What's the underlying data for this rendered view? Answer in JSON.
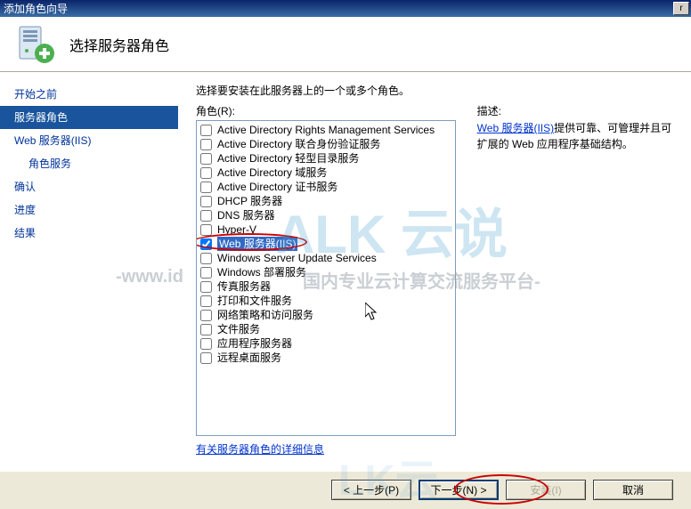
{
  "window": {
    "title": "添加角色向导"
  },
  "header": {
    "title": "选择服务器角色"
  },
  "sidebar": {
    "items": [
      {
        "label": "开始之前",
        "selected": false,
        "indent": false
      },
      {
        "label": "服务器角色",
        "selected": true,
        "indent": false
      },
      {
        "label": "Web 服务器(IIS)",
        "selected": false,
        "indent": false
      },
      {
        "label": "角色服务",
        "selected": false,
        "indent": true
      },
      {
        "label": "确认",
        "selected": false,
        "indent": false
      },
      {
        "label": "进度",
        "selected": false,
        "indent": false
      },
      {
        "label": "结果",
        "selected": false,
        "indent": false
      }
    ]
  },
  "main": {
    "instruction": "选择要安装在此服务器上的一个或多个角色。",
    "roles_label": "角色(R):",
    "desc_label": "描述:",
    "desc_link_text": "Web 服务器(IIS)",
    "desc_body": "提供可靠、可管理并且可扩展的 Web 应用程序基础结构。",
    "roles": [
      {
        "label": "Active Directory Rights Management Services",
        "checked": false
      },
      {
        "label": "Active Directory 联合身份验证服务",
        "checked": false
      },
      {
        "label": "Active Directory 轻型目录服务",
        "checked": false
      },
      {
        "label": "Active Directory 域服务",
        "checked": false
      },
      {
        "label": "Active Directory 证书服务",
        "checked": false
      },
      {
        "label": "DHCP 服务器",
        "checked": false
      },
      {
        "label": "DNS 服务器",
        "checked": false
      },
      {
        "label": "Hyper-V",
        "checked": false
      },
      {
        "label": "Web 服务器(IIS)",
        "checked": true,
        "selected": true
      },
      {
        "label": "Windows Server Update Services",
        "checked": false
      },
      {
        "label": "Windows 部署服务",
        "checked": false
      },
      {
        "label": "传真服务器",
        "checked": false
      },
      {
        "label": "打印和文件服务",
        "checked": false
      },
      {
        "label": "网络策略和访问服务",
        "checked": false
      },
      {
        "label": "文件服务",
        "checked": false
      },
      {
        "label": "应用程序服务器",
        "checked": false
      },
      {
        "label": "远程桌面服务",
        "checked": false
      }
    ],
    "detail_link": "有关服务器角色的详细信息"
  },
  "buttons": {
    "prev": "< 上一步(P)",
    "next": "下一步(N) >",
    "install": "安装(I)",
    "cancel": "取消"
  },
  "watermarks": {
    "wm1": "ALK 云说",
    "wm2": "-www.id",
    "wm3": "国内专业云计算交流服务平台-",
    "wm4": "LK云"
  }
}
